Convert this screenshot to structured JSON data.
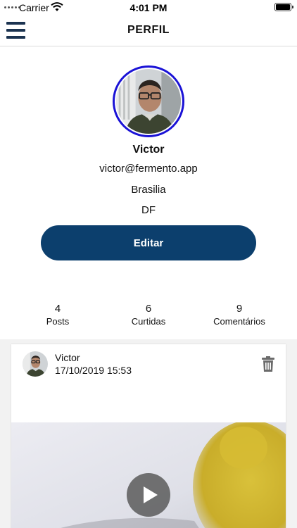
{
  "status_bar": {
    "carrier": "Carrier",
    "time": "4:01 PM"
  },
  "header": {
    "title": "PERFIL",
    "menu_icon": "hamburger-menu-icon"
  },
  "profile": {
    "name": "Victor",
    "email": "victor@fermento.app",
    "city": "Brasilia",
    "state": "DF",
    "edit_label": "Editar",
    "accent_color": "#0c3f6d",
    "avatar_ring_color": "#1a12d6"
  },
  "stats": [
    {
      "value": "4",
      "label": "Posts"
    },
    {
      "value": "6",
      "label": "Curtidas"
    },
    {
      "value": "9",
      "label": "Comentários"
    }
  ],
  "post": {
    "author": "Victor",
    "datetime": "17/10/2019 15:53",
    "delete_icon": "trash-icon",
    "media_icon": "play-icon"
  }
}
